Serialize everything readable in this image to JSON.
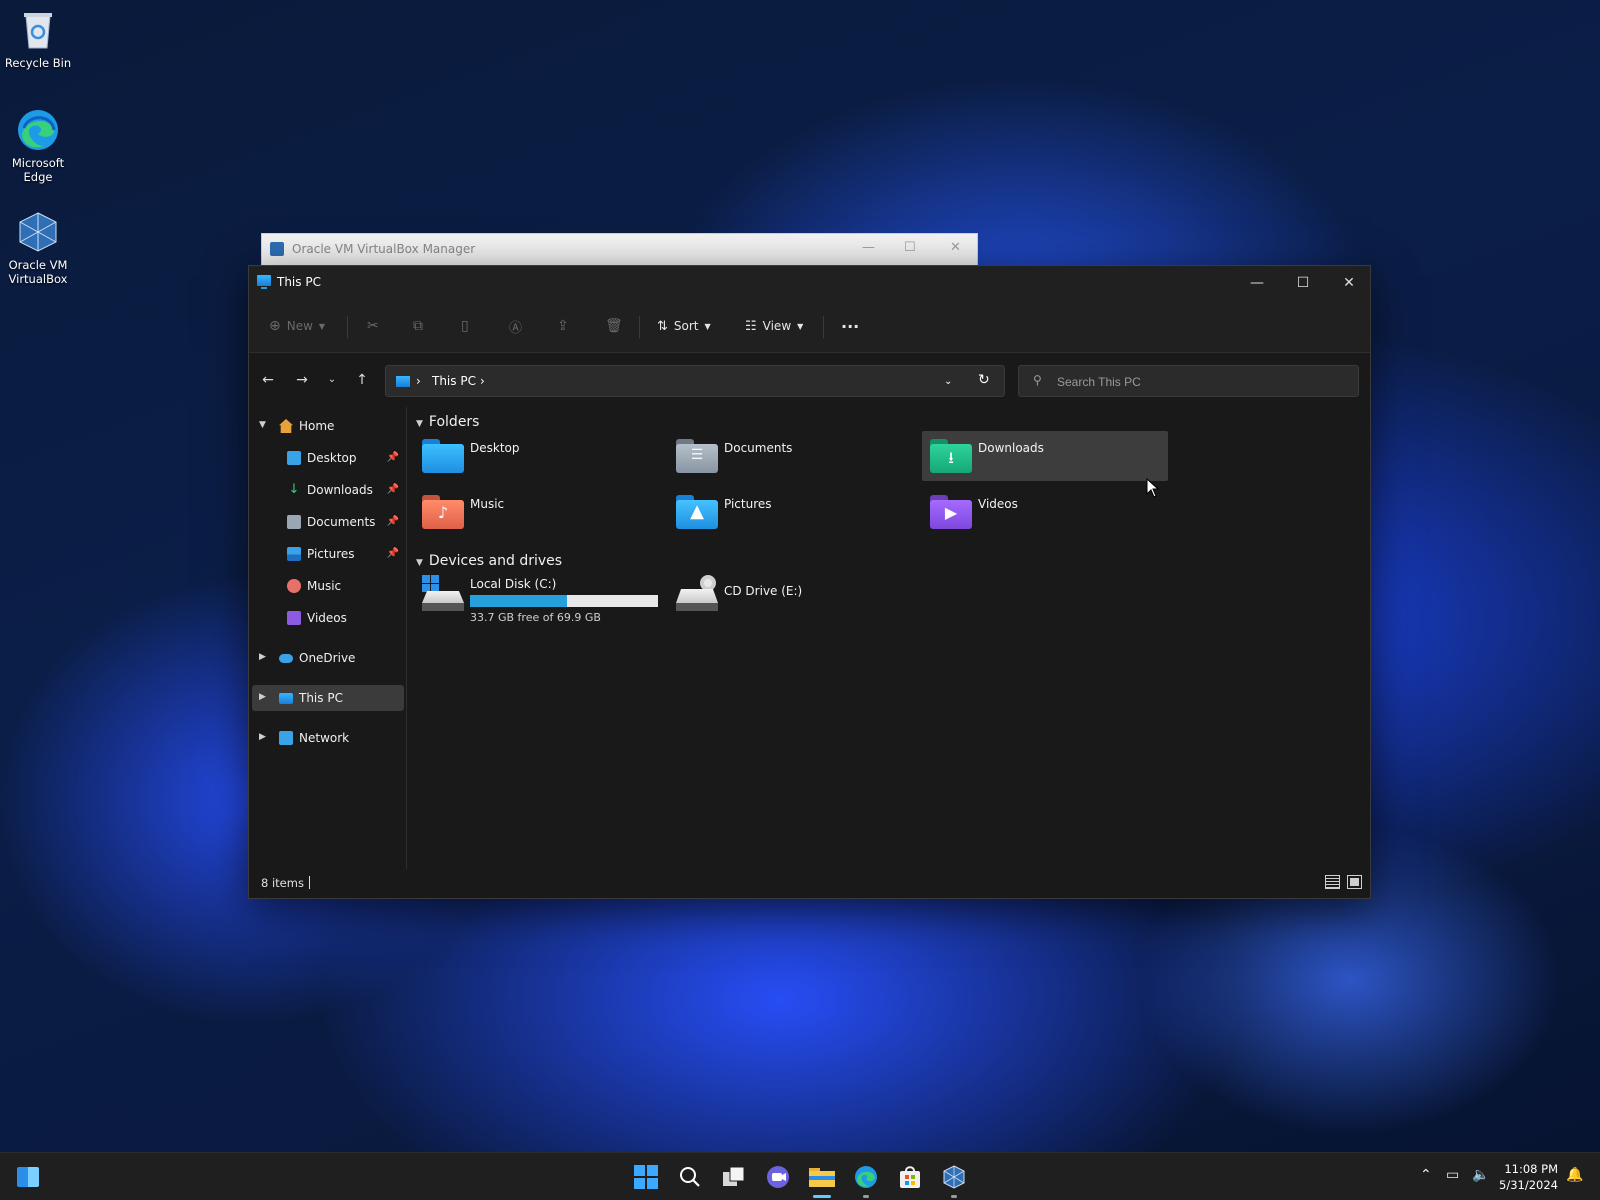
{
  "desktop": {
    "icons": [
      {
        "label": "Recycle Bin"
      },
      {
        "label": "Microsoft Edge"
      },
      {
        "label": "Oracle VM VirtualBox"
      }
    ]
  },
  "background_window": {
    "title": "Oracle VM VirtualBox Manager"
  },
  "window": {
    "title": "This PC",
    "controls": {
      "minimize": "—",
      "maximize": "☐",
      "close": "✕"
    }
  },
  "toolbar": {
    "new_label": "New",
    "sort_label": "Sort",
    "view_label": "View",
    "more_label": "···"
  },
  "address_bar": {
    "crumb": "This PC",
    "search_placeholder": "Search This PC"
  },
  "sidebar": {
    "home": "Home",
    "items": [
      {
        "label": "Desktop",
        "pinned": true
      },
      {
        "label": "Downloads",
        "pinned": true
      },
      {
        "label": "Documents",
        "pinned": true
      },
      {
        "label": "Pictures",
        "pinned": true
      },
      {
        "label": "Music",
        "pinned": false
      },
      {
        "label": "Videos",
        "pinned": false
      }
    ],
    "onedrive": "OneDrive",
    "this_pc": "This PC",
    "network": "Network"
  },
  "content": {
    "folders_header": "Folders",
    "folders": [
      {
        "label": "Desktop"
      },
      {
        "label": "Documents"
      },
      {
        "label": "Downloads"
      },
      {
        "label": "Music"
      },
      {
        "label": "Pictures"
      },
      {
        "label": "Videos"
      }
    ],
    "drives_header": "Devices and drives",
    "drives": [
      {
        "label": "Local Disk (C:)",
        "free_text": "33.7 GB free of 69.9 GB",
        "used_fraction": 0.518
      },
      {
        "label": "CD Drive (E:)"
      }
    ]
  },
  "status": {
    "item_count": "8 items"
  },
  "taskbar": {
    "time": "11:08 PM",
    "date": "5/31/2024"
  },
  "colors": {
    "accent": "#26a0da",
    "window_bg": "#191919",
    "selection": "#3d3d3d"
  }
}
